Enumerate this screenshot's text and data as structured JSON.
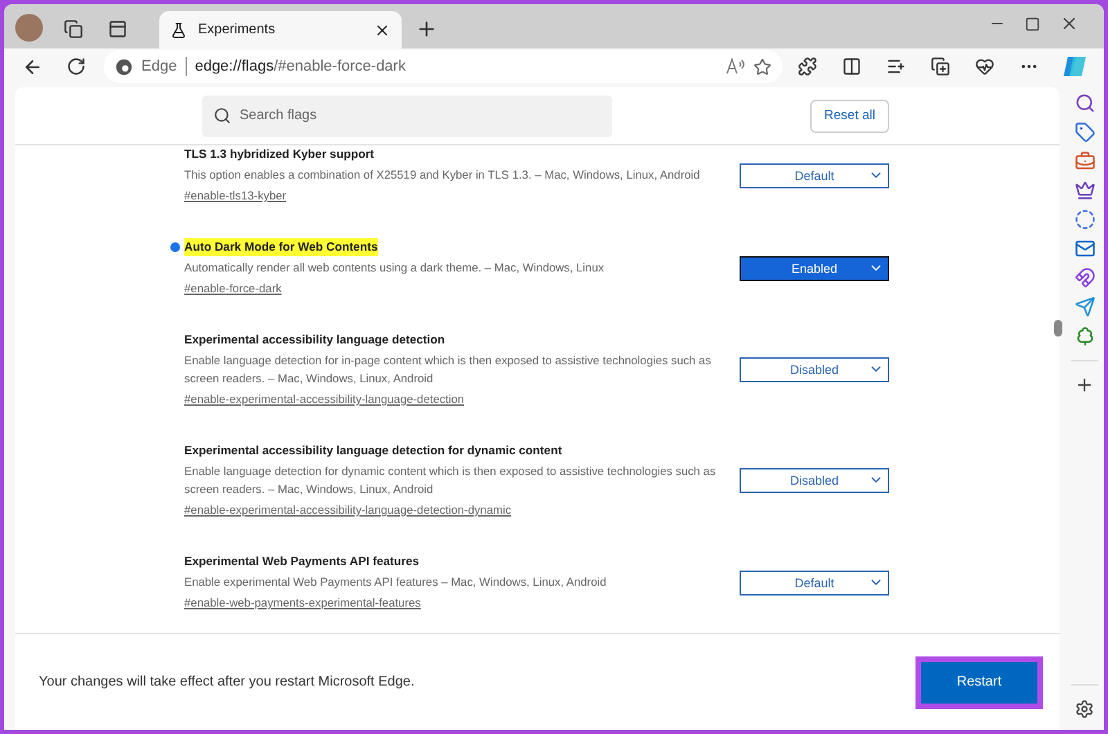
{
  "tabs": [
    {
      "title": "Experiments",
      "selected": true
    }
  ],
  "address_bar": {
    "site_label": "Edge",
    "url_host": "edge://flags",
    "url_rest": "/#enable-force-dark"
  },
  "search": {
    "placeholder": "Search flags"
  },
  "reset_button": "Reset all",
  "flags": [
    {
      "title": "TLS 1.3 hybridized Kyber support",
      "description": "This option enables a combination of X25519 and Kyber in TLS 1.3. – Mac, Windows, Linux, Android",
      "link": "#enable-tls13-kyber",
      "value": "Default",
      "modified": false
    },
    {
      "title": "Auto Dark Mode for Web Contents",
      "description": "Automatically render all web contents using a dark theme. – Mac, Windows, Linux",
      "link": "#enable-force-dark",
      "value": "Enabled",
      "modified": true
    },
    {
      "title": "Experimental accessibility language detection",
      "description": "Enable language detection for in-page content which is then exposed to assistive technologies such as screen readers. – Mac, Windows, Linux, Android",
      "link": "#enable-experimental-accessibility-language-detection",
      "value": "Disabled",
      "modified": false
    },
    {
      "title": "Experimental accessibility language detection for dynamic content",
      "description": "Enable language detection for dynamic content which is then exposed to assistive technologies such as screen readers. – Mac, Windows, Linux, Android",
      "link": "#enable-experimental-accessibility-language-detection-dynamic",
      "value": "Disabled",
      "modified": false
    },
    {
      "title": "Experimental Web Payments API features",
      "description": "Enable experimental Web Payments API features – Mac, Windows, Linux, Android",
      "link": "#enable-web-payments-experimental-features",
      "value": "Default",
      "modified": false
    }
  ],
  "footer": {
    "message": "Your changes will take effect after you restart Microsoft Edge.",
    "button": "Restart"
  }
}
